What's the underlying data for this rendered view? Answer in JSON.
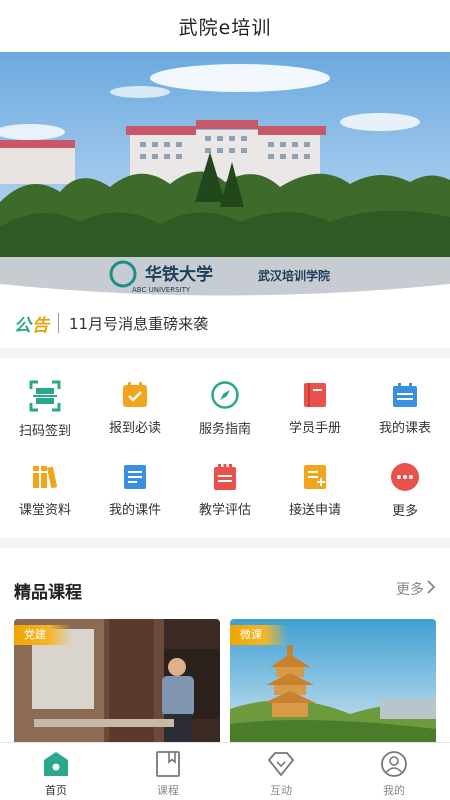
{
  "header": {
    "title": "武院e培训"
  },
  "banner": {
    "logo_text": "ABC UNIVERSITY",
    "seal_text": "华铁大学 武汉培训学院"
  },
  "notice": {
    "tag_a": "公",
    "tag_b": "告",
    "message": "11月号消息重磅来袭"
  },
  "grid": {
    "items": [
      {
        "label": "扫码签到",
        "icon": "scan-icon"
      },
      {
        "label": "报到必读",
        "icon": "calendar-check-icon"
      },
      {
        "label": "服务指南",
        "icon": "compass-icon"
      },
      {
        "label": "学员手册",
        "icon": "book-icon"
      },
      {
        "label": "我的课表",
        "icon": "schedule-icon"
      },
      {
        "label": "课堂资料",
        "icon": "books-icon"
      },
      {
        "label": "我的课件",
        "icon": "document-icon"
      },
      {
        "label": "教学评估",
        "icon": "clipboard-icon"
      },
      {
        "label": "接送申请",
        "icon": "application-icon"
      },
      {
        "label": "更多",
        "icon": "more-icon"
      }
    ]
  },
  "courses": {
    "title": "精品课程",
    "more_label": "更多",
    "cards": [
      {
        "badge": "党建"
      },
      {
        "badge": "微课"
      }
    ]
  },
  "tabs": [
    {
      "label": "首页",
      "icon": "home-icon",
      "active": true
    },
    {
      "label": "课程",
      "icon": "course-icon"
    },
    {
      "label": "互动",
      "icon": "interact-icon"
    },
    {
      "label": "我的",
      "icon": "profile-icon"
    }
  ],
  "colors": {
    "accent": "#2aa78c",
    "orange": "#f0a500",
    "red": "#e8524a",
    "blue": "#3a8fe0"
  }
}
